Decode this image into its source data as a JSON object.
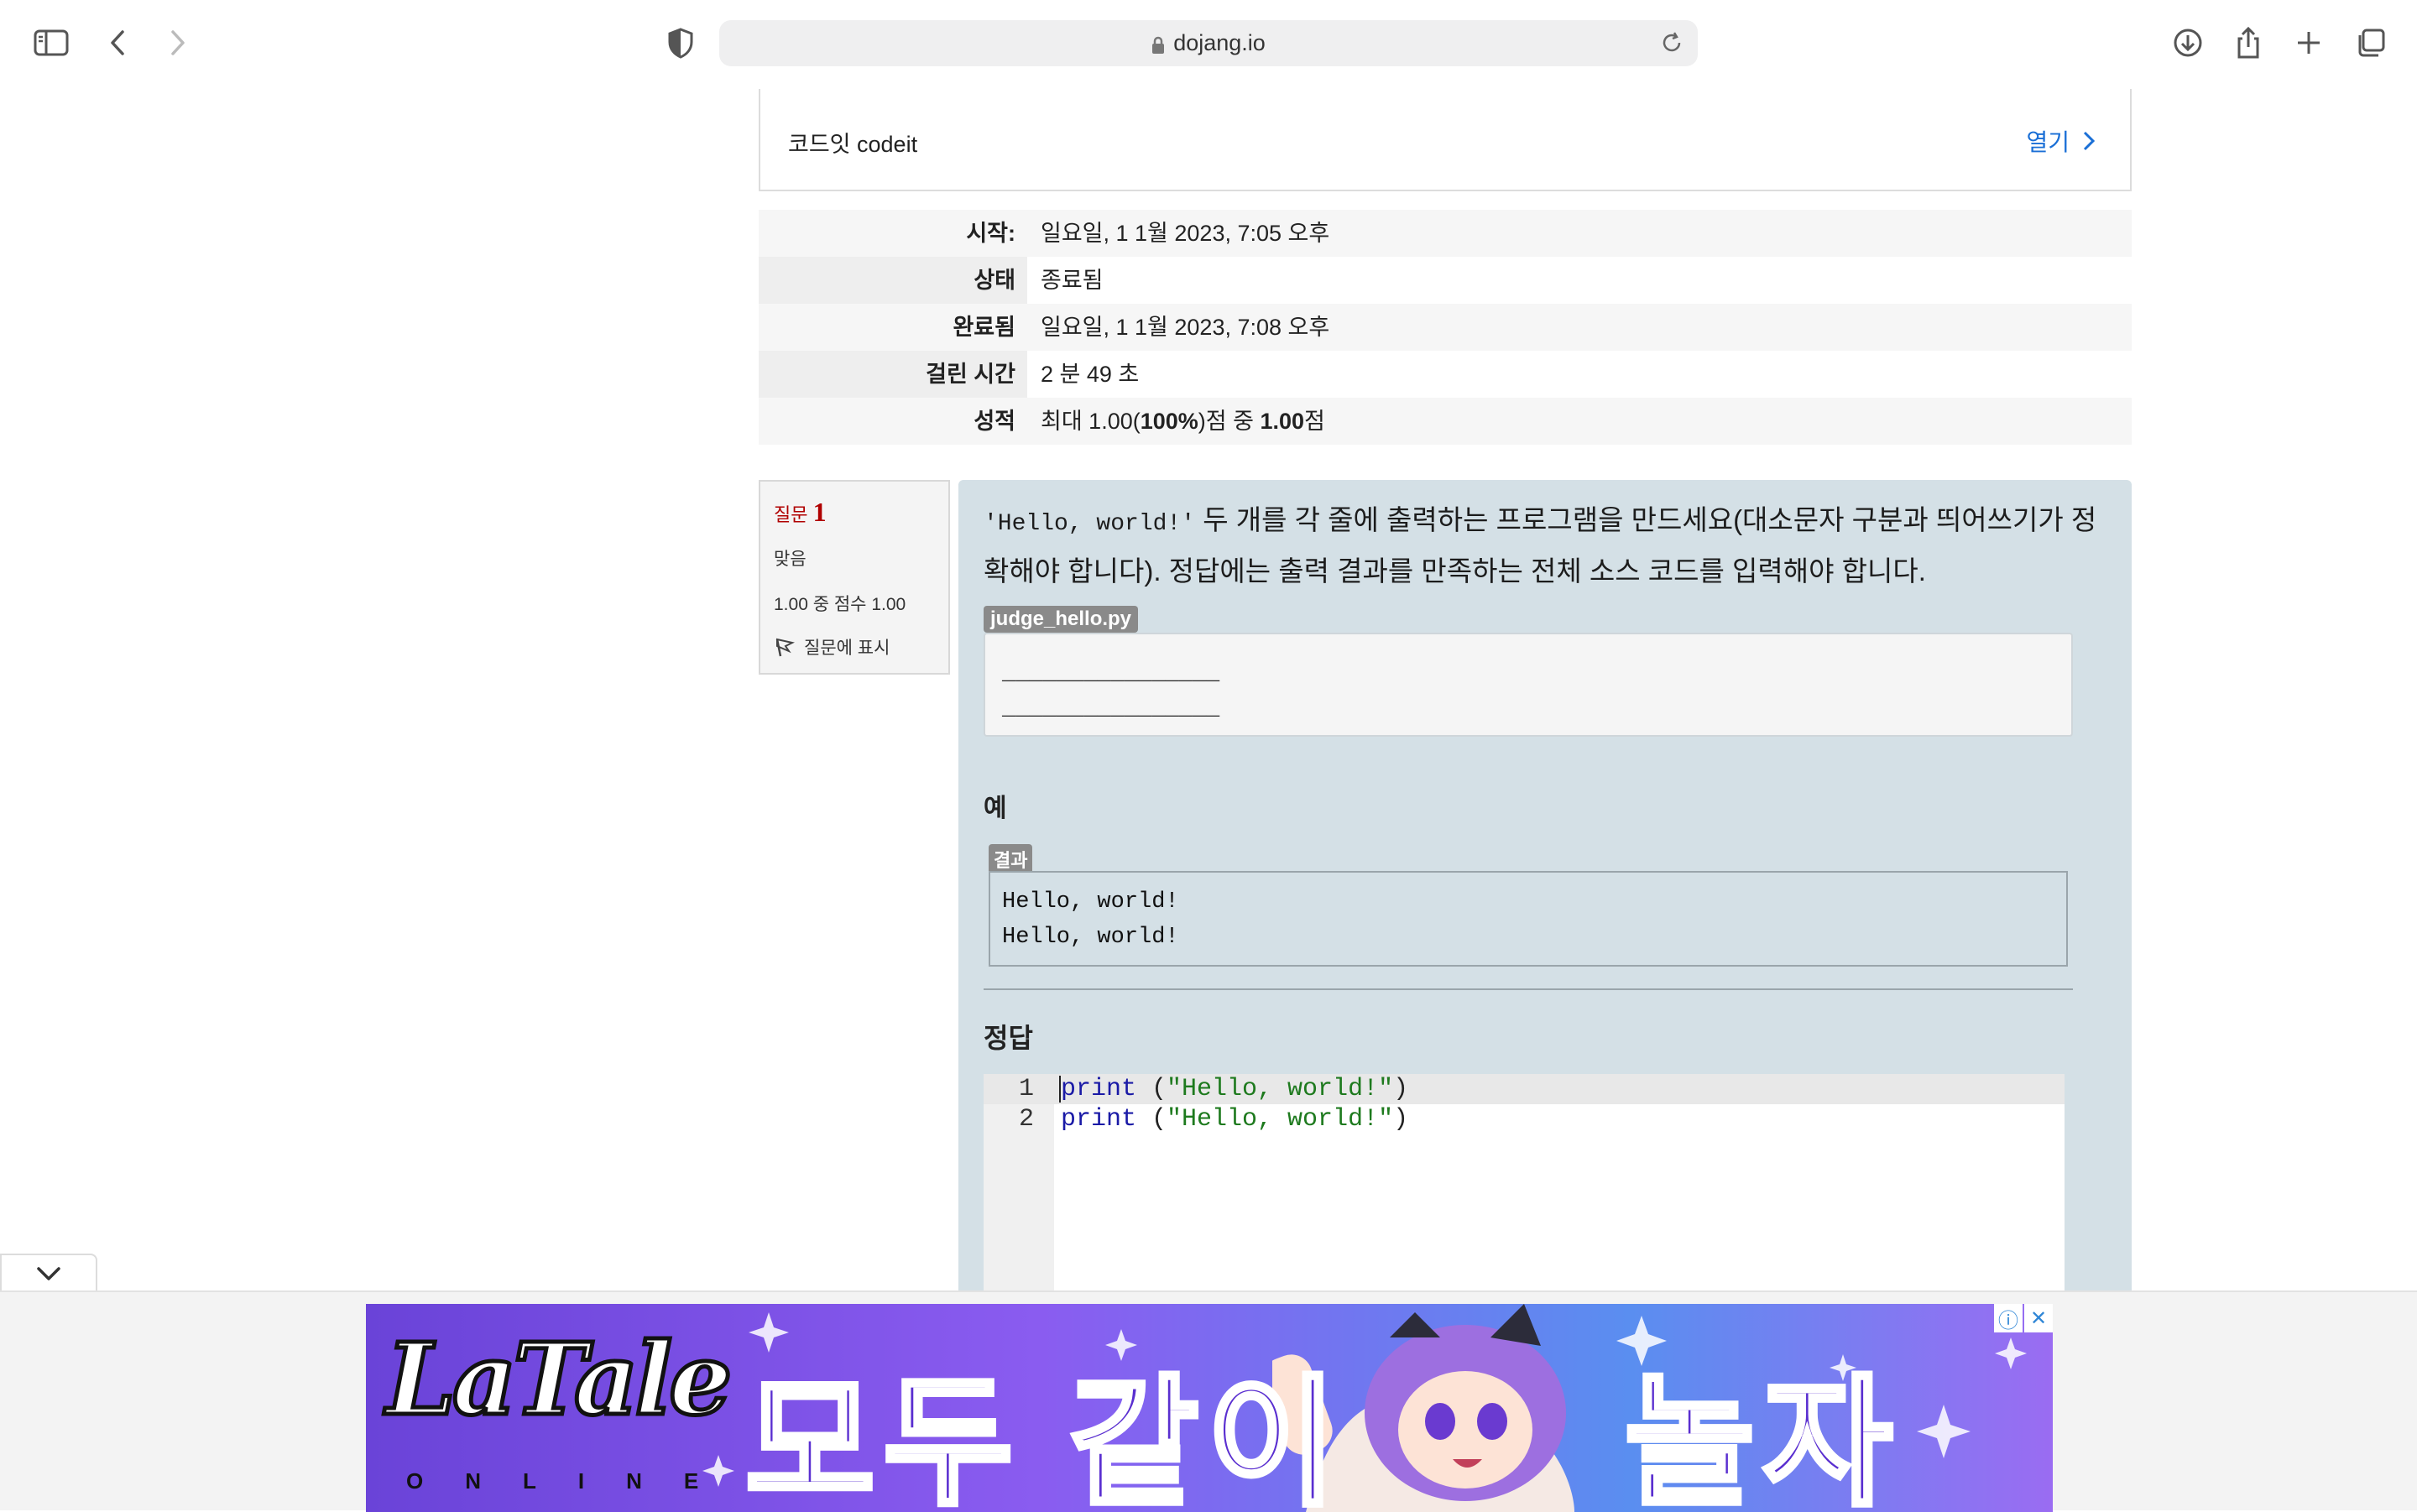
{
  "browser": {
    "url": "dojang.io"
  },
  "codeit": {
    "label": "코드잇 codeit",
    "open_label": "열기"
  },
  "summary": [
    {
      "label": "시작:",
      "value": "일요일, 1 1월 2023, 7:05 오후"
    },
    {
      "label": "상태",
      "value": "종료됨"
    },
    {
      "label": "완료됨",
      "value": "일요일, 1 1월 2023, 7:08 오후"
    },
    {
      "label": "걸린 시간",
      "value": "2 분 49 초"
    },
    {
      "label": "성적",
      "value_pre": "최대 1.00(",
      "value_b1": "100%",
      "value_mid": ")점 중 ",
      "value_b2": "1.00",
      "value_post": "점"
    }
  ],
  "question_info": {
    "label": "질문",
    "number": "1",
    "state": "맞음",
    "grade": "1.00 중 점수 1.00",
    "flag_label": "질문에 표시"
  },
  "question": {
    "code_inline": "'Hello, world!'",
    "text": " 두 개를 각 줄에 출력하는 프로그램을 만드세요(대소문자 구분과 띄어쓰기가 정확해야 합니다). 정답에는 출력 결과를 만족하는 전체 소스 코드를 입력해야 합니다.",
    "file_name": "judge_hello.py",
    "file_lines": [
      "________________",
      "________________"
    ],
    "example_heading": "예",
    "result_badge": "결과",
    "result_lines": [
      "Hello, world!",
      "Hello, world!"
    ],
    "answer_heading": "정답",
    "code_lines": [
      {
        "num": "1",
        "kw": "print",
        "rest_open": " (",
        "str": "\"Hello, world!\"",
        "rest_close": ")"
      },
      {
        "num": "2",
        "kw": "print",
        "rest_open": " (",
        "str": "\"Hello, world!\"",
        "rest_close": ")"
      }
    ]
  },
  "ad": {
    "logo": "LaTale",
    "logo_sub": "ONLINE",
    "text1": "모두 같이",
    "text2": "놀자",
    "info_icon": "ⓘ",
    "close_icon": "✕"
  }
}
